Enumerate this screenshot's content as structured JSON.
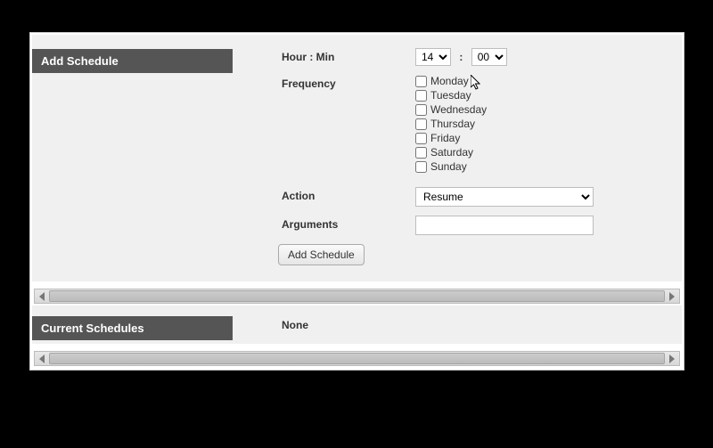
{
  "addSchedule": {
    "title": "Add Schedule",
    "labels": {
      "hourMin": "Hour : Min",
      "frequency": "Frequency",
      "action": "Action",
      "arguments": "Arguments"
    },
    "hour": "14",
    "minute": "00",
    "colon": ":",
    "days": [
      "Monday",
      "Tuesday",
      "Wednesday",
      "Thursday",
      "Friday",
      "Saturday",
      "Sunday"
    ],
    "actionValue": "Resume",
    "argumentsValue": "",
    "submitLabel": "Add Schedule"
  },
  "currentSchedules": {
    "title": "Current Schedules",
    "none": "None"
  }
}
